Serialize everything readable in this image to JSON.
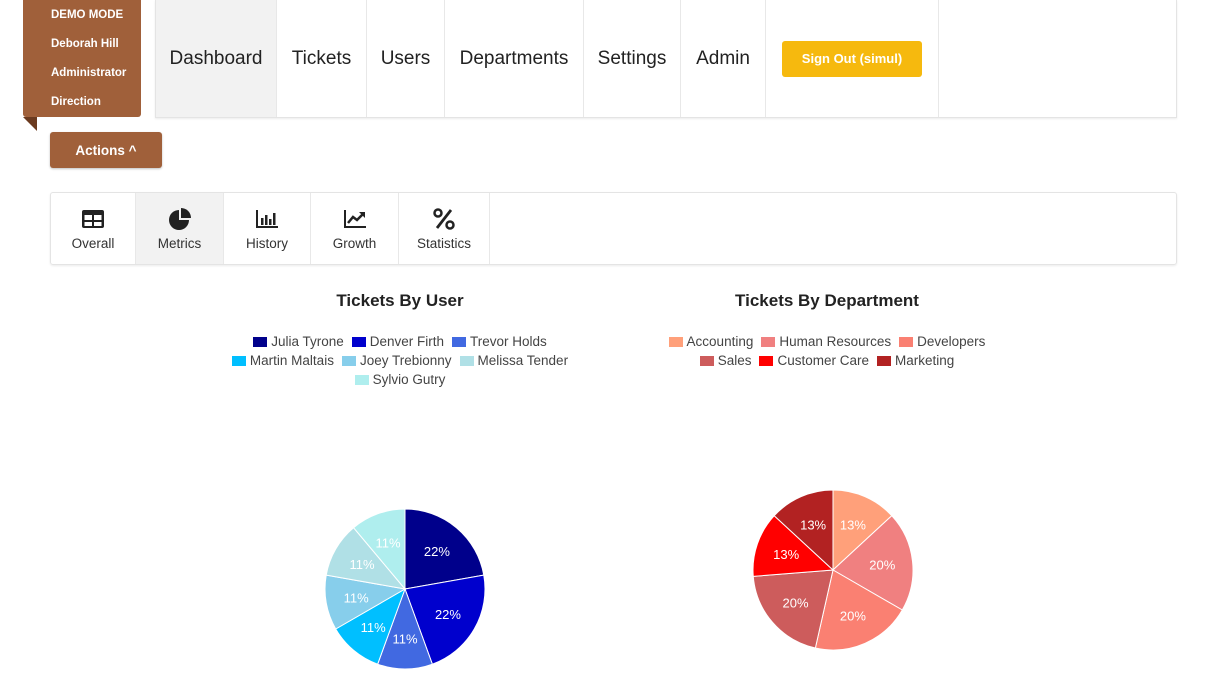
{
  "user_ribbon": {
    "mode": "DEMO MODE",
    "name": "Deborah Hill",
    "role": "Administrator",
    "department": "Direction"
  },
  "nav": {
    "dashboard": "Dashboard",
    "tickets": "Tickets",
    "users": "Users",
    "departments": "Departments",
    "settings": "Settings",
    "admin": "Admin",
    "signout": "Sign Out (simul)"
  },
  "actions_label": "Actions ^",
  "subnav": {
    "overall": "Overall",
    "metrics": "Metrics",
    "history": "History",
    "growth": "Growth",
    "statistics": "Statistics"
  },
  "chart_data": [
    {
      "type": "pie",
      "title": "Tickets By User",
      "categories": [
        "Julia Tyrone",
        "Denver Firth",
        "Trevor Holds",
        "Martin Maltais",
        "Joey Trebionny",
        "Melissa Tender",
        "Sylvio Gutry"
      ],
      "values": [
        22,
        22,
        11,
        11,
        11,
        11,
        11
      ],
      "labels": [
        "22%",
        "22%",
        "11%",
        "11%",
        "11%",
        "11%",
        "11%"
      ],
      "colors": [
        "#00008b",
        "#0000cd",
        "#4169e1",
        "#00bfff",
        "#87ceeb",
        "#b0e0e6",
        "#afeeee"
      ],
      "legend": "top"
    },
    {
      "type": "pie",
      "title": "Tickets By Department",
      "categories": [
        "Accounting",
        "Human Resources",
        "Developers",
        "Sales",
        "Customer Care",
        "Marketing"
      ],
      "values": [
        13,
        20,
        20,
        20,
        13,
        13
      ],
      "labels": [
        "13%",
        "20%",
        "20%",
        "20%",
        "13%",
        "13%"
      ],
      "colors": [
        "#ffa07a",
        "#f08080",
        "#fa8072",
        "#cd5c5c",
        "#ff0000",
        "#b22222"
      ],
      "legend": "top"
    }
  ]
}
